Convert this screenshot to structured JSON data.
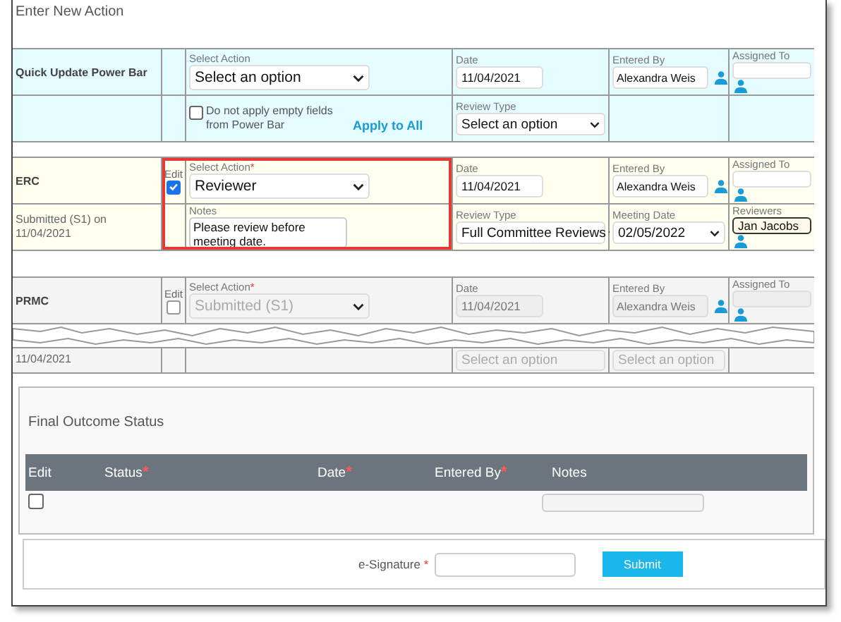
{
  "section_title": "Enter New Action",
  "groups": [
    {
      "kind": "powerbar",
      "title": "Quick Update Power Bar",
      "disabled": false,
      "highlighted": false,
      "action": {
        "label": "Select Action",
        "value": "Select an option"
      },
      "date": {
        "label": "Date",
        "value": "11/04/2021"
      },
      "entered_by": {
        "label": "Entered By",
        "value": "Alexandra Weis"
      },
      "assigned_to": {
        "label": "Assigned To"
      },
      "option": {
        "text": "Do not apply empty fields from Power Bar",
        "checked": false
      },
      "apply_link": "Apply to All",
      "review_type": {
        "label": "Review Type",
        "value": "Select an option"
      }
    },
    {
      "kind": "committee",
      "title": "ERC",
      "status": "Submitted (S1) on 11/04/2021",
      "disabled": false,
      "highlighted": true,
      "edit": {
        "label": "Edit",
        "checked": true
      },
      "action": {
        "label": "Select Action",
        "required_mark": "*",
        "value": "Reviewer"
      },
      "date": {
        "label": "Date",
        "value": "11/04/2021"
      },
      "entered_by": {
        "label": "Entered By",
        "value": "Alexandra Weis"
      },
      "assigned_to": {
        "label": "Assigned To"
      },
      "notes": {
        "label": "Notes",
        "value": "Please review before meeting date."
      },
      "review_type": {
        "label": "Review Type",
        "value": "Full Committee Reviews"
      },
      "meeting_date": {
        "label": "Meeting Date",
        "value": "02/05/2022"
      },
      "reviewers": {
        "label": "Reviewers",
        "value": "Jan Jacobs"
      }
    },
    {
      "kind": "committee",
      "title": "PRMC",
      "disabled": true,
      "highlighted": false,
      "edit": {
        "label": "Edit",
        "checked": false
      },
      "action": {
        "label": "Select Action",
        "required_mark": "*",
        "value": "Submitted (S1)"
      },
      "date": {
        "label": "Date",
        "value": "11/04/2021"
      },
      "entered_by": {
        "label": "Entered By",
        "value": "Alexandra Weis"
      },
      "assigned_to": {
        "label": "Assigned To"
      },
      "fragment": {
        "status": "11/04/2021",
        "selects": [
          "Select an option",
          "Select an option"
        ]
      }
    }
  ],
  "final_outcome": {
    "title": "Final Outcome Status",
    "columns": [
      {
        "label": "Edit"
      },
      {
        "label": "Status",
        "required_mark": "*"
      },
      {
        "label": "Date",
        "required_mark": "*"
      },
      {
        "label": "Entered By",
        "required_mark": "*"
      },
      {
        "label": "Notes"
      }
    ],
    "rows": [
      {
        "checked": false
      }
    ]
  },
  "signature": {
    "label": "e-Signature",
    "required_mark": "*",
    "button": "Submit"
  }
}
